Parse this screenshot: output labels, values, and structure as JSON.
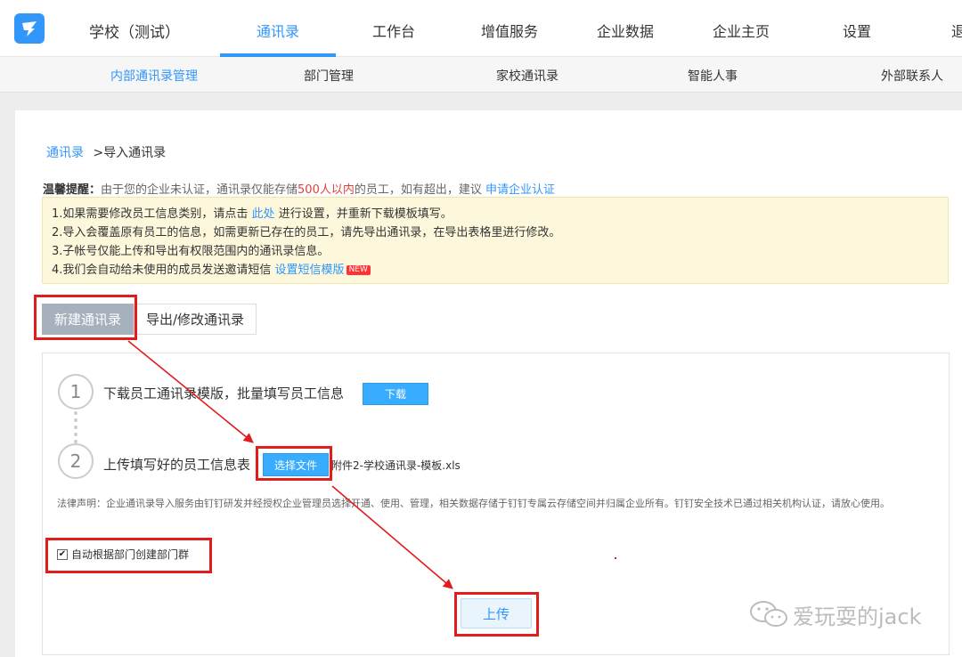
{
  "app": {
    "org_name": "学校（测试）"
  },
  "nav": {
    "items": [
      "通讯录",
      "工作台",
      "增值服务",
      "企业数据",
      "企业主页",
      "设置"
    ],
    "active": "通讯录",
    "cut_item": "退"
  },
  "subnav": {
    "items": [
      "内部通讯录管理",
      "部门管理",
      "家校通讯录",
      "智能人事",
      "外部联系人"
    ],
    "active": "内部通讯录管理"
  },
  "breadcrumb": {
    "root": "通讯录",
    "separator": ">",
    "current": "导入通讯录"
  },
  "tip": {
    "label": "温馨提醒：",
    "text_before": "由于您的企业未认证，通讯录仅能存储",
    "limit": "500人以内",
    "text_after": "的员工，如有超出，建议",
    "link": "申请企业认证"
  },
  "notice": {
    "line1_before": "1.如果需要修改员工信息类别，请点击",
    "line1_link": "此处",
    "line1_after": "进行设置，并重新下载模板填写。",
    "line2": "2.导入会覆盖原有员工的信息，如需更新已存在的员工，请先导出通讯录，在导出表格里进行修改。",
    "line3": "3.子帐号仅能上传和导出有权限范围内的通讯录信息。",
    "line4_before": "4.我们会自动给未使用的成员发送邀请短信",
    "line4_link": "设置短信模版",
    "line4_badge": "NEW"
  },
  "tabs": {
    "new": "新建通讯录",
    "export": "导出/修改通讯录"
  },
  "steps": {
    "s1_num": "1",
    "s1_text": "下载员工通讯录模版，批量填写员工信息",
    "s1_button": "下载",
    "s2_num": "2",
    "s2_text": "上传填写好的员工信息表",
    "s2_button": "选择文件",
    "s2_file": "附件2-学校通讯录-模板.xls"
  },
  "legal": "法律声明：企业通讯录导入服务由钉钉研发并经授权企业管理员选择开通、使用、管理，相关数据存储于钉钉专属云存储空间并归属企业所有。钉钉安全技术已通过相关机构认证，请放心使用。",
  "checkbox": {
    "label": "自动根据部门创建部门群",
    "checked": true
  },
  "upload_button": "上传",
  "watermark": "爱玩耍的jack",
  "colors": {
    "accent": "#3296fa",
    "highlight": "#e21b1b",
    "notice_bg": "#fdf8dc"
  }
}
